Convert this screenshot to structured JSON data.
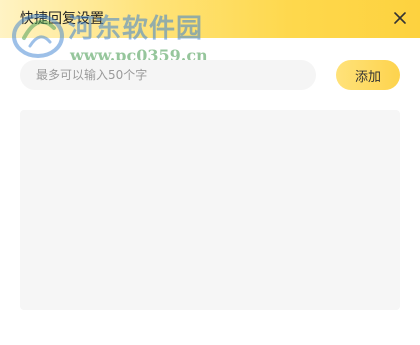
{
  "window": {
    "title": "快捷回复设置",
    "close_icon": "close-icon"
  },
  "watermark": {
    "site_name": "河东软件园",
    "url": "www.pc0359.cn",
    "logo_icon": "watermark-logo-icon"
  },
  "reply_form": {
    "input_value": "",
    "input_placeholder": "最多可以输入50个字",
    "add_label": "添加"
  },
  "reply_list": {
    "items": []
  },
  "colors": {
    "accent": "#fdd34d",
    "titlebar_start": "#fff3c4",
    "titlebar_end": "#fdd23f",
    "input_bg": "#f5f5f5",
    "list_bg": "#f6f6f6"
  }
}
